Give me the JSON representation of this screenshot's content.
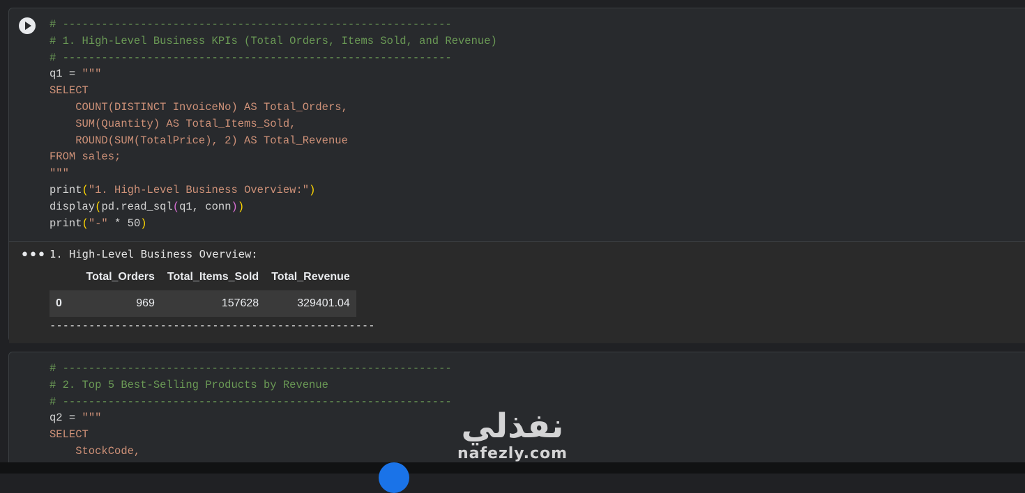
{
  "cell1": {
    "code": [
      "# ------------------------------------------------------------",
      "# 1. High-Level Business KPIs (Total Orders, Items Sold, and Revenue)",
      "q1 = \"\"\"",
      "SELECT",
      "    COUNT(DISTINCT InvoiceNo) AS Total_Orders,",
      "    SUM(Quantity) AS Total_Items_Sold,",
      "    ROUND(SUM(TotalPrice), 2) AS Total_Revenue",
      "FROM sales;",
      "\"\"\"",
      "print(",
      "\"1. High-Level Business Overview:\"",
      ")",
      "display",
      "(",
      "pd.read_sql",
      "q1, conn",
      "\"-\"",
      " * 50",
      "print"
    ],
    "output": {
      "text": "1. High-Level Business Overview:",
      "table": {
        "columns": [
          "",
          "Total_Orders",
          "Total_Items_Sold",
          "Total_Revenue"
        ],
        "rows": [
          [
            "0",
            "969",
            "157628",
            "329401.04"
          ]
        ]
      },
      "divider": "--------------------------------------------------"
    }
  },
  "cell2": {
    "code": [
      "# 2. Top 5 Best-Selling Products by Revenue",
      "q2 = \"\"\"",
      "    StockCode,"
    ]
  },
  "watermark": {
    "logo": "نفذلي",
    "url": "nafezly.com"
  }
}
